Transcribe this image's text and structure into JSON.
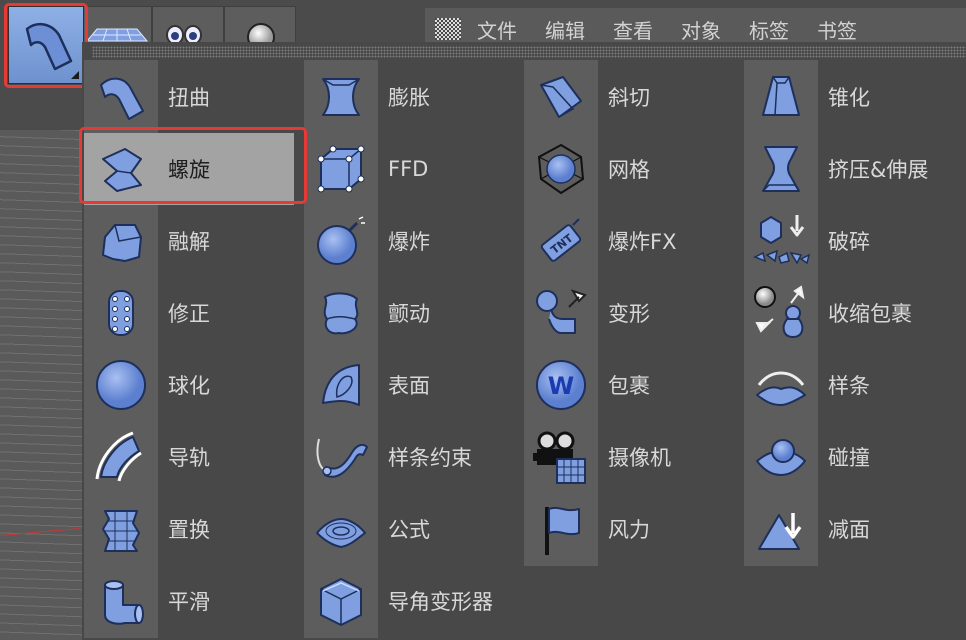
{
  "window": {
    "menubar": [
      "文件",
      "编辑",
      "查看",
      "对象",
      "标签",
      "书签"
    ]
  },
  "toolbar": {
    "active_tool": "deformer-group",
    "buttons": [
      "plane-grid-icon",
      "eyes-icon",
      "sphere-light-icon"
    ]
  },
  "accent": "#e63a36",
  "icon_color": "#7f9fe0",
  "deformers": {
    "col1": [
      {
        "label": "扭曲",
        "icon": "bend-icon"
      },
      {
        "label": "螺旋",
        "icon": "twist-icon",
        "selected": true
      },
      {
        "label": "融解",
        "icon": "melt-icon"
      },
      {
        "label": "修正",
        "icon": "correction-icon"
      },
      {
        "label": "球化",
        "icon": "spherify-icon"
      },
      {
        "label": "导轨",
        "icon": "rail-icon"
      },
      {
        "label": "置换",
        "icon": "displacer-icon"
      },
      {
        "label": "平滑",
        "icon": "smoothing-icon"
      }
    ],
    "col2": [
      {
        "label": "膨胀",
        "icon": "bulge-icon"
      },
      {
        "label": "FFD",
        "icon": "ffd-icon"
      },
      {
        "label": "爆炸",
        "icon": "explosion-icon"
      },
      {
        "label": "颤动",
        "icon": "jiggle-icon"
      },
      {
        "label": "表面",
        "icon": "surface-icon"
      },
      {
        "label": "样条约束",
        "icon": "spline-wrap-icon"
      },
      {
        "label": "公式",
        "icon": "formula-icon"
      },
      {
        "label": "导角变形器",
        "icon": "bevel-deformer-icon"
      }
    ],
    "col3": [
      {
        "label": "斜切",
        "icon": "shear-icon"
      },
      {
        "label": "网格",
        "icon": "mesh-icon"
      },
      {
        "label": "爆炸FX",
        "icon": "explosion-fx-icon"
      },
      {
        "label": "变形",
        "icon": "morph-icon"
      },
      {
        "label": "包裹",
        "icon": "wrap-icon"
      },
      {
        "label": "摄像机",
        "icon": "camera-icon"
      },
      {
        "label": "风力",
        "icon": "wind-icon"
      }
    ],
    "col4": [
      {
        "label": "锥化",
        "icon": "taper-icon"
      },
      {
        "label": "挤压&伸展",
        "icon": "squash-stretch-icon"
      },
      {
        "label": "破碎",
        "icon": "shatter-icon"
      },
      {
        "label": "收缩包裹",
        "icon": "shrink-wrap-icon"
      },
      {
        "label": "样条",
        "icon": "spline-icon"
      },
      {
        "label": "碰撞",
        "icon": "collision-icon"
      },
      {
        "label": "减面",
        "icon": "polygon-reduction-icon"
      }
    ]
  }
}
